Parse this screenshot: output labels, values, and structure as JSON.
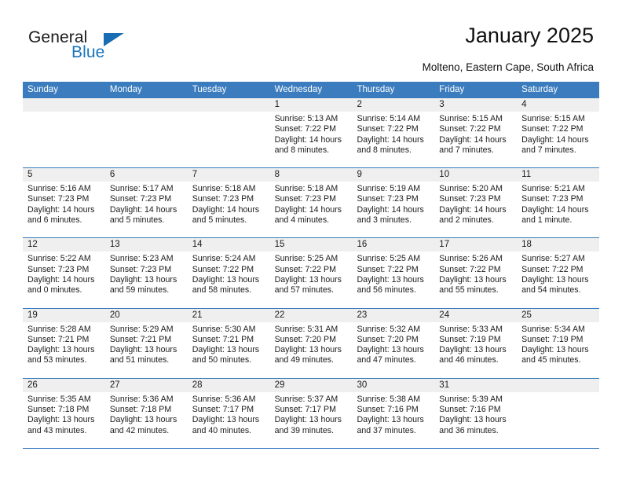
{
  "brand": {
    "name_part1": "General",
    "name_part2": "Blue",
    "accent_color": "#1a75bc",
    "flag_icon": "triangle-flag-icon"
  },
  "header": {
    "title": "January 2025",
    "subtitle": "Molteno, Eastern Cape, South Africa"
  },
  "calendar": {
    "header_bg": "#3a7cbe",
    "day_number_bg": "#efefef",
    "weekdays": [
      "Sunday",
      "Monday",
      "Tuesday",
      "Wednesday",
      "Thursday",
      "Friday",
      "Saturday"
    ],
    "weeks": [
      [
        {
          "day": "",
          "sunrise": "",
          "sunset": "",
          "daylight_line1": "",
          "daylight_line2": "",
          "empty": true
        },
        {
          "day": "",
          "sunrise": "",
          "sunset": "",
          "daylight_line1": "",
          "daylight_line2": "",
          "empty": true
        },
        {
          "day": "",
          "sunrise": "",
          "sunset": "",
          "daylight_line1": "",
          "daylight_line2": "",
          "empty": true
        },
        {
          "day": "1",
          "sunrise": "Sunrise: 5:13 AM",
          "sunset": "Sunset: 7:22 PM",
          "daylight_line1": "Daylight: 14 hours",
          "daylight_line2": "and 8 minutes."
        },
        {
          "day": "2",
          "sunrise": "Sunrise: 5:14 AM",
          "sunset": "Sunset: 7:22 PM",
          "daylight_line1": "Daylight: 14 hours",
          "daylight_line2": "and 8 minutes."
        },
        {
          "day": "3",
          "sunrise": "Sunrise: 5:15 AM",
          "sunset": "Sunset: 7:22 PM",
          "daylight_line1": "Daylight: 14 hours",
          "daylight_line2": "and 7 minutes."
        },
        {
          "day": "4",
          "sunrise": "Sunrise: 5:15 AM",
          "sunset": "Sunset: 7:22 PM",
          "daylight_line1": "Daylight: 14 hours",
          "daylight_line2": "and 7 minutes."
        }
      ],
      [
        {
          "day": "5",
          "sunrise": "Sunrise: 5:16 AM",
          "sunset": "Sunset: 7:23 PM",
          "daylight_line1": "Daylight: 14 hours",
          "daylight_line2": "and 6 minutes."
        },
        {
          "day": "6",
          "sunrise": "Sunrise: 5:17 AM",
          "sunset": "Sunset: 7:23 PM",
          "daylight_line1": "Daylight: 14 hours",
          "daylight_line2": "and 5 minutes."
        },
        {
          "day": "7",
          "sunrise": "Sunrise: 5:18 AM",
          "sunset": "Sunset: 7:23 PM",
          "daylight_line1": "Daylight: 14 hours",
          "daylight_line2": "and 5 minutes."
        },
        {
          "day": "8",
          "sunrise": "Sunrise: 5:18 AM",
          "sunset": "Sunset: 7:23 PM",
          "daylight_line1": "Daylight: 14 hours",
          "daylight_line2": "and 4 minutes."
        },
        {
          "day": "9",
          "sunrise": "Sunrise: 5:19 AM",
          "sunset": "Sunset: 7:23 PM",
          "daylight_line1": "Daylight: 14 hours",
          "daylight_line2": "and 3 minutes."
        },
        {
          "day": "10",
          "sunrise": "Sunrise: 5:20 AM",
          "sunset": "Sunset: 7:23 PM",
          "daylight_line1": "Daylight: 14 hours",
          "daylight_line2": "and 2 minutes."
        },
        {
          "day": "11",
          "sunrise": "Sunrise: 5:21 AM",
          "sunset": "Sunset: 7:23 PM",
          "daylight_line1": "Daylight: 14 hours",
          "daylight_line2": "and 1 minute."
        }
      ],
      [
        {
          "day": "12",
          "sunrise": "Sunrise: 5:22 AM",
          "sunset": "Sunset: 7:23 PM",
          "daylight_line1": "Daylight: 14 hours",
          "daylight_line2": "and 0 minutes."
        },
        {
          "day": "13",
          "sunrise": "Sunrise: 5:23 AM",
          "sunset": "Sunset: 7:23 PM",
          "daylight_line1": "Daylight: 13 hours",
          "daylight_line2": "and 59 minutes."
        },
        {
          "day": "14",
          "sunrise": "Sunrise: 5:24 AM",
          "sunset": "Sunset: 7:22 PM",
          "daylight_line1": "Daylight: 13 hours",
          "daylight_line2": "and 58 minutes."
        },
        {
          "day": "15",
          "sunrise": "Sunrise: 5:25 AM",
          "sunset": "Sunset: 7:22 PM",
          "daylight_line1": "Daylight: 13 hours",
          "daylight_line2": "and 57 minutes."
        },
        {
          "day": "16",
          "sunrise": "Sunrise: 5:25 AM",
          "sunset": "Sunset: 7:22 PM",
          "daylight_line1": "Daylight: 13 hours",
          "daylight_line2": "and 56 minutes."
        },
        {
          "day": "17",
          "sunrise": "Sunrise: 5:26 AM",
          "sunset": "Sunset: 7:22 PM",
          "daylight_line1": "Daylight: 13 hours",
          "daylight_line2": "and 55 minutes."
        },
        {
          "day": "18",
          "sunrise": "Sunrise: 5:27 AM",
          "sunset": "Sunset: 7:22 PM",
          "daylight_line1": "Daylight: 13 hours",
          "daylight_line2": "and 54 minutes."
        }
      ],
      [
        {
          "day": "19",
          "sunrise": "Sunrise: 5:28 AM",
          "sunset": "Sunset: 7:21 PM",
          "daylight_line1": "Daylight: 13 hours",
          "daylight_line2": "and 53 minutes."
        },
        {
          "day": "20",
          "sunrise": "Sunrise: 5:29 AM",
          "sunset": "Sunset: 7:21 PM",
          "daylight_line1": "Daylight: 13 hours",
          "daylight_line2": "and 51 minutes."
        },
        {
          "day": "21",
          "sunrise": "Sunrise: 5:30 AM",
          "sunset": "Sunset: 7:21 PM",
          "daylight_line1": "Daylight: 13 hours",
          "daylight_line2": "and 50 minutes."
        },
        {
          "day": "22",
          "sunrise": "Sunrise: 5:31 AM",
          "sunset": "Sunset: 7:20 PM",
          "daylight_line1": "Daylight: 13 hours",
          "daylight_line2": "and 49 minutes."
        },
        {
          "day": "23",
          "sunrise": "Sunrise: 5:32 AM",
          "sunset": "Sunset: 7:20 PM",
          "daylight_line1": "Daylight: 13 hours",
          "daylight_line2": "and 47 minutes."
        },
        {
          "day": "24",
          "sunrise": "Sunrise: 5:33 AM",
          "sunset": "Sunset: 7:19 PM",
          "daylight_line1": "Daylight: 13 hours",
          "daylight_line2": "and 46 minutes."
        },
        {
          "day": "25",
          "sunrise": "Sunrise: 5:34 AM",
          "sunset": "Sunset: 7:19 PM",
          "daylight_line1": "Daylight: 13 hours",
          "daylight_line2": "and 45 minutes."
        }
      ],
      [
        {
          "day": "26",
          "sunrise": "Sunrise: 5:35 AM",
          "sunset": "Sunset: 7:18 PM",
          "daylight_line1": "Daylight: 13 hours",
          "daylight_line2": "and 43 minutes."
        },
        {
          "day": "27",
          "sunrise": "Sunrise: 5:36 AM",
          "sunset": "Sunset: 7:18 PM",
          "daylight_line1": "Daylight: 13 hours",
          "daylight_line2": "and 42 minutes."
        },
        {
          "day": "28",
          "sunrise": "Sunrise: 5:36 AM",
          "sunset": "Sunset: 7:17 PM",
          "daylight_line1": "Daylight: 13 hours",
          "daylight_line2": "and 40 minutes."
        },
        {
          "day": "29",
          "sunrise": "Sunrise: 5:37 AM",
          "sunset": "Sunset: 7:17 PM",
          "daylight_line1": "Daylight: 13 hours",
          "daylight_line2": "and 39 minutes."
        },
        {
          "day": "30",
          "sunrise": "Sunrise: 5:38 AM",
          "sunset": "Sunset: 7:16 PM",
          "daylight_line1": "Daylight: 13 hours",
          "daylight_line2": "and 37 minutes."
        },
        {
          "day": "31",
          "sunrise": "Sunrise: 5:39 AM",
          "sunset": "Sunset: 7:16 PM",
          "daylight_line1": "Daylight: 13 hours",
          "daylight_line2": "and 36 minutes."
        },
        {
          "day": "",
          "sunrise": "",
          "sunset": "",
          "daylight_line1": "",
          "daylight_line2": "",
          "empty": true
        }
      ]
    ]
  }
}
